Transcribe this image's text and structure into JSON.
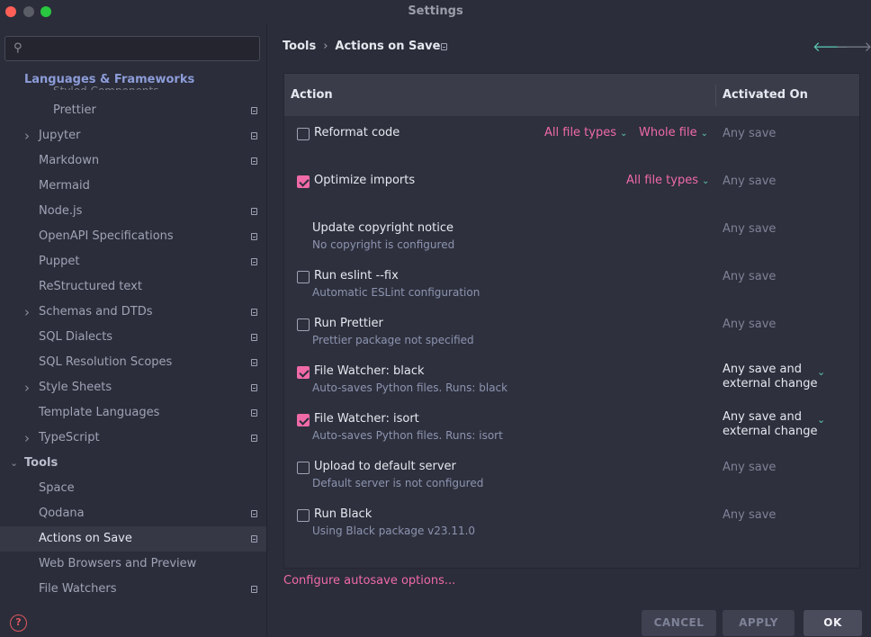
{
  "window": {
    "title": "Settings"
  },
  "sidebar": {
    "search": {
      "value": "",
      "placeholder": ""
    },
    "section_header": "Languages & Frameworks",
    "clipped_item": "Styled Components",
    "items": [
      {
        "label": "Prettier",
        "indent": 2,
        "chevron": "",
        "project_icon": true
      },
      {
        "label": "Jupyter",
        "indent": 1,
        "chevron": "right",
        "project_icon": true
      },
      {
        "label": "Markdown",
        "indent": 1,
        "chevron": "",
        "project_icon": true
      },
      {
        "label": "Mermaid",
        "indent": 1,
        "chevron": "",
        "project_icon": false
      },
      {
        "label": "Node.js",
        "indent": 1,
        "chevron": "",
        "project_icon": true
      },
      {
        "label": "OpenAPI Specifications",
        "indent": 1,
        "chevron": "",
        "project_icon": true
      },
      {
        "label": "Puppet",
        "indent": 1,
        "chevron": "",
        "project_icon": true
      },
      {
        "label": "ReStructured text",
        "indent": 1,
        "chevron": "",
        "project_icon": false
      },
      {
        "label": "Schemas and DTDs",
        "indent": 1,
        "chevron": "right",
        "project_icon": true
      },
      {
        "label": "SQL Dialects",
        "indent": 1,
        "chevron": "",
        "project_icon": true
      },
      {
        "label": "SQL Resolution Scopes",
        "indent": 1,
        "chevron": "",
        "project_icon": true
      },
      {
        "label": "Style Sheets",
        "indent": 1,
        "chevron": "right",
        "project_icon": true
      },
      {
        "label": "Template Languages",
        "indent": 1,
        "chevron": "",
        "project_icon": true
      },
      {
        "label": "TypeScript",
        "indent": 1,
        "chevron": "right",
        "project_icon": true
      },
      {
        "label": "Tools",
        "indent": 0,
        "chevron": "down",
        "project_icon": false
      },
      {
        "label": "Space",
        "indent": 1,
        "chevron": "",
        "project_icon": false
      },
      {
        "label": "Qodana",
        "indent": 1,
        "chevron": "",
        "project_icon": true
      },
      {
        "label": "Actions on Save",
        "indent": 1,
        "chevron": "",
        "project_icon": true,
        "selected": true
      },
      {
        "label": "Web Browsers and Preview",
        "indent": 1,
        "chevron": "",
        "project_icon": false
      },
      {
        "label": "File Watchers",
        "indent": 1,
        "chevron": "",
        "project_icon": true
      }
    ]
  },
  "breadcrumb": {
    "parent": "Tools",
    "separator": "›",
    "current": "Actions on Save"
  },
  "table": {
    "headers": {
      "action": "Action",
      "activated_on": "Activated On"
    },
    "rows": [
      {
        "title": "Reformat code",
        "subtitle": "",
        "checkbox": "unchecked",
        "dropdowns": [
          "All file types",
          "Whole file"
        ],
        "activated_on": "Any save",
        "activated_dropdown": false
      },
      {
        "title": "Optimize imports",
        "subtitle": "",
        "checkbox": "checked",
        "dropdowns": [
          "All file types"
        ],
        "activated_on": "Any save",
        "activated_dropdown": false
      },
      {
        "title": "Update copyright notice",
        "subtitle": "No copyright is configured",
        "checkbox": "none",
        "dropdowns": [],
        "activated_on": "Any save",
        "activated_dropdown": false
      },
      {
        "title": "Run eslint --fix",
        "subtitle": "Automatic ESLint configuration",
        "checkbox": "unchecked",
        "dropdowns": [],
        "activated_on": "Any save",
        "activated_dropdown": false
      },
      {
        "title": "Run Prettier",
        "subtitle": "Prettier package not specified",
        "checkbox": "unchecked",
        "dropdowns": [],
        "activated_on": "Any save",
        "activated_dropdown": false
      },
      {
        "title": "File Watcher: black",
        "subtitle": "Auto-saves Python files. Runs: black",
        "checkbox": "checked",
        "dropdowns": [],
        "activated_on": "Any save and\nexternal change",
        "activated_dropdown": true
      },
      {
        "title": "File Watcher: isort",
        "subtitle": "Auto-saves Python files. Runs: isort",
        "checkbox": "checked",
        "dropdowns": [],
        "activated_on": "Any save and\nexternal change",
        "activated_dropdown": true
      },
      {
        "title": "Upload to default server",
        "subtitle": "Default server is not configured",
        "checkbox": "unchecked",
        "dropdowns": [],
        "activated_on": "Any save",
        "activated_dropdown": false
      },
      {
        "title": "Run Black",
        "subtitle": "Using Black package v23.11.0",
        "checkbox": "unchecked",
        "dropdowns": [],
        "activated_on": "Any save",
        "activated_dropdown": false
      }
    ]
  },
  "configure_link": "Configure autosave options...",
  "buttons": {
    "cancel": "CANCEL",
    "apply": "APPLY",
    "ok": "OK"
  },
  "colors": {
    "accent_pink": "#f06aa8",
    "accent_teal": "#5ec9b8",
    "background": "#2b2d3a"
  }
}
